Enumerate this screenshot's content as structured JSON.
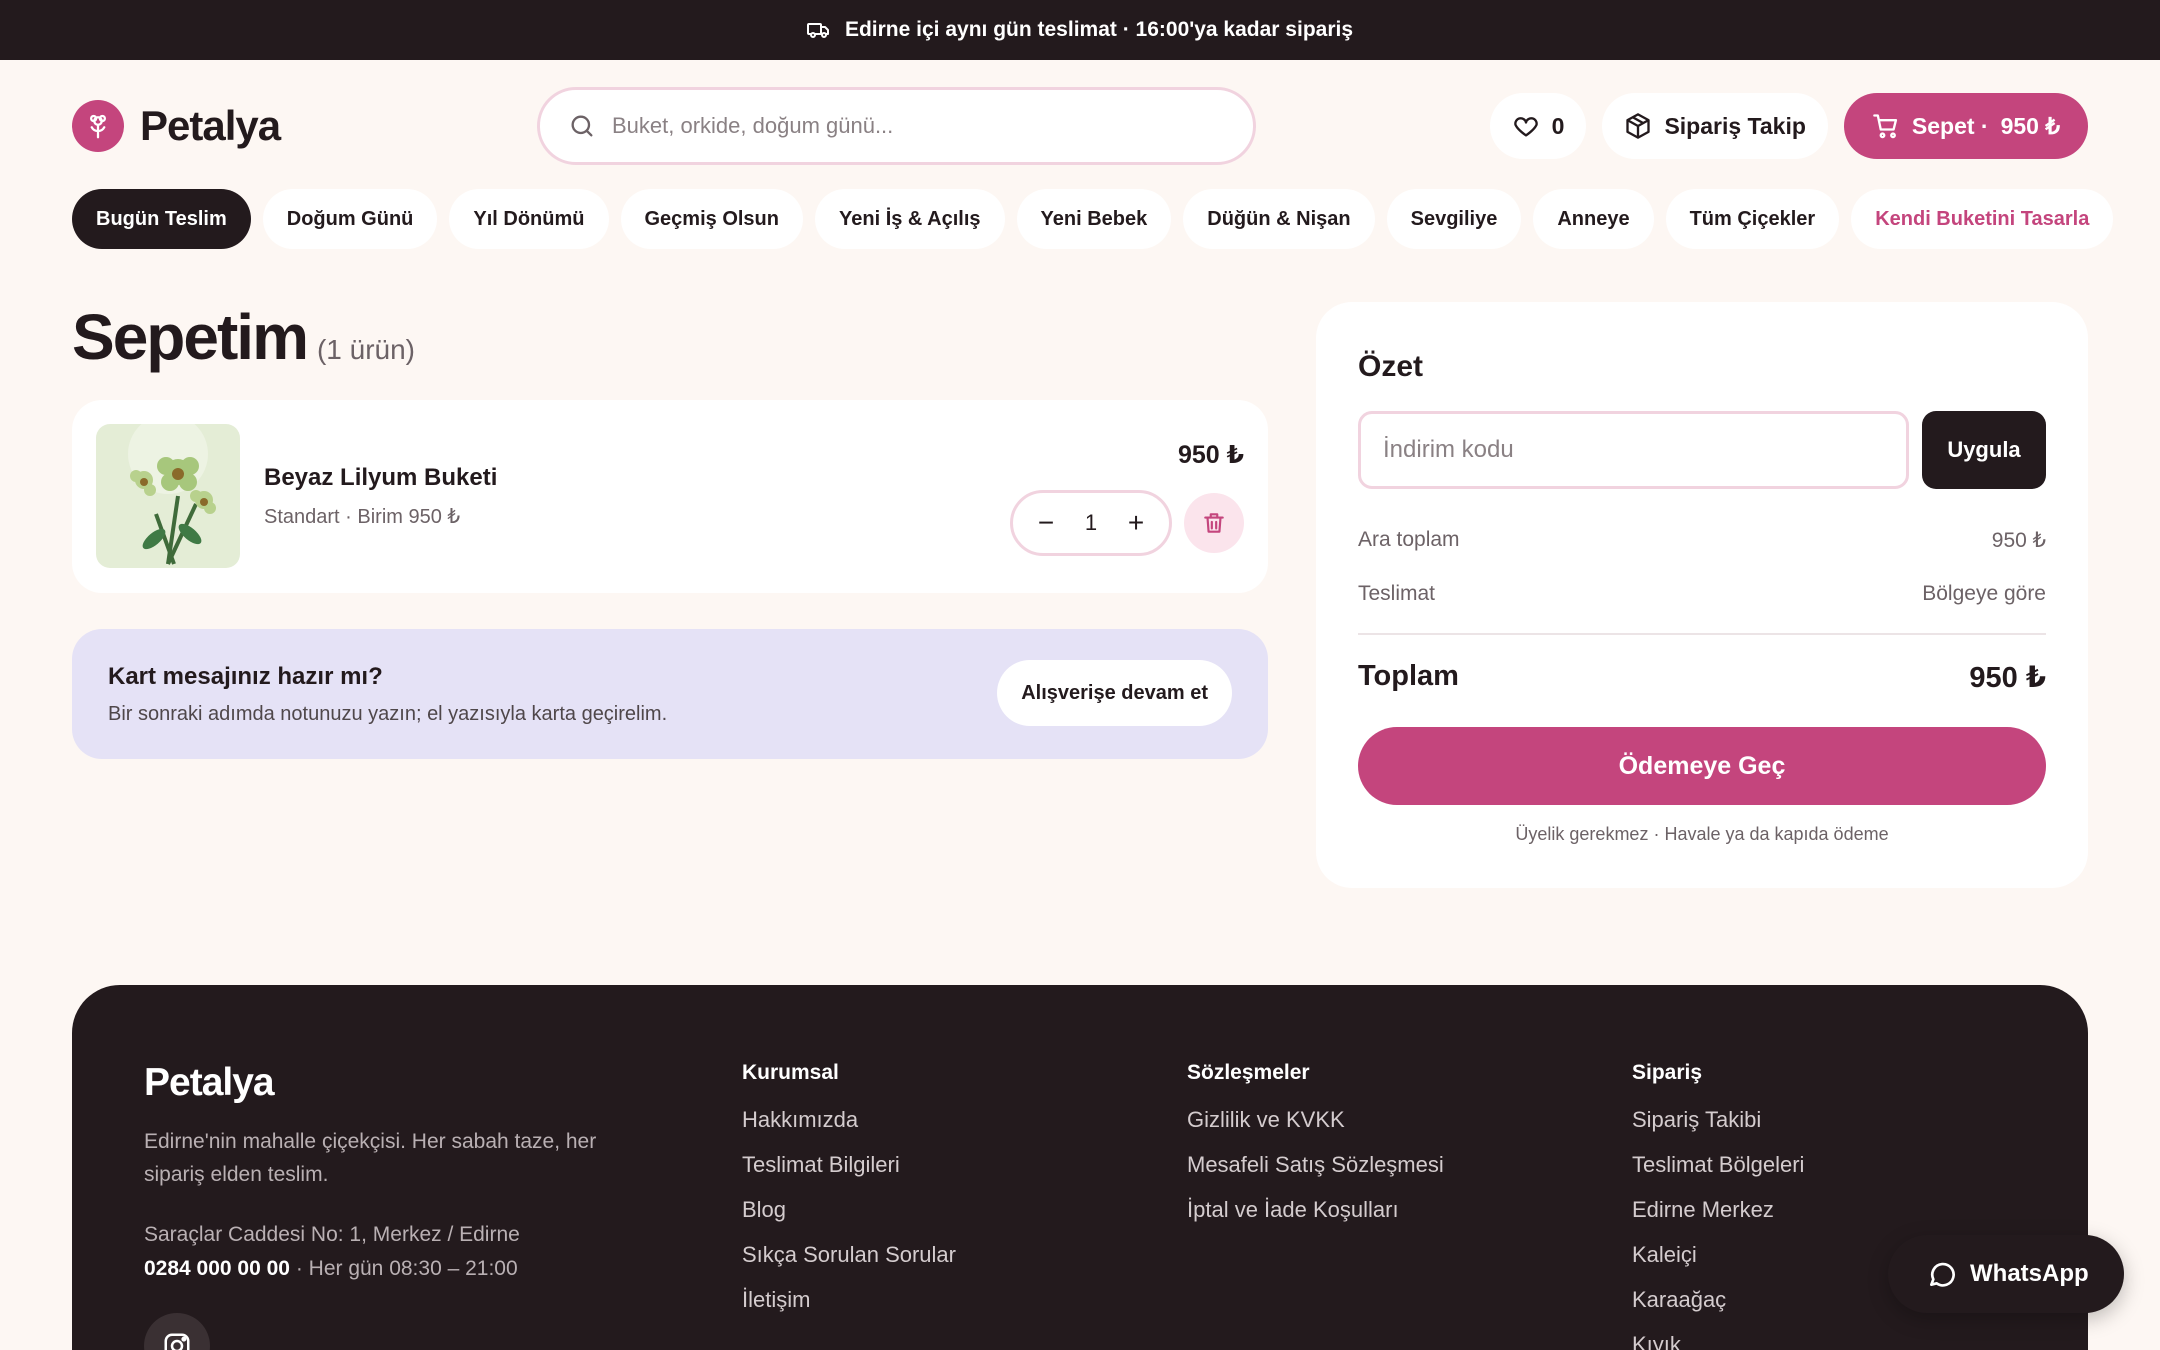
{
  "announcement": {
    "text": "Edirne içi aynı gün teslimat · 16:00'ya kadar sipariş",
    "icon": "truck-icon"
  },
  "header": {
    "logo_text": "Petalya",
    "search_placeholder": "Buket, orkide, doğum günü...",
    "favorites_count": "0",
    "order_tracking_label": "Sipariş Takip",
    "cart_label": "Sepet ·",
    "cart_total": "950 ₺"
  },
  "categories": [
    {
      "label": "Bugün Teslim",
      "active": true
    },
    {
      "label": "Doğum Günü"
    },
    {
      "label": "Yıl Dönümü"
    },
    {
      "label": "Geçmiş Olsun"
    },
    {
      "label": "Yeni İş & Açılış"
    },
    {
      "label": "Yeni Bebek"
    },
    {
      "label": "Düğün & Nişan"
    },
    {
      "label": "Sevgiliye"
    },
    {
      "label": "Anneye"
    },
    {
      "label": "Tüm Çiçekler"
    },
    {
      "label": "Kendi Buketini Tasarla",
      "accent": true
    }
  ],
  "cart": {
    "title": "Sepetim",
    "count_label": "(1 ürün)",
    "items": [
      {
        "name": "Beyaz Lilyum Buketi",
        "subtitle": "Standart · Birim 950 ₺",
        "price": "950 ₺",
        "quantity": "1"
      }
    ]
  },
  "card_message": {
    "title": "Kart mesajınız hazır mı?",
    "text": "Bir sonraki adımda notunuzu yazın; el yazısıyla karta geçirelim.",
    "button": "Alışverişe devam et"
  },
  "summary": {
    "title": "Özet",
    "promo_placeholder": "İndirim kodu",
    "apply_label": "Uygula",
    "subtotal_label": "Ara toplam",
    "subtotal_value": "950 ₺",
    "delivery_label": "Teslimat",
    "delivery_value": "Bölgeye göre",
    "total_label": "Toplam",
    "total_value": "950 ₺",
    "checkout_label": "Ödemeye Geç",
    "note": "Üyelik gerekmez · Havale ya da kapıda ödeme"
  },
  "footer": {
    "brand": "Petalya",
    "description": "Edirne'nin mahalle çiçekçisi. Her sabah taze, her sipariş elden teslim.",
    "address": "Saraçlar Caddesi No: 1, Merkez / Edirne",
    "phone": "0284 000 00 00",
    "hours": "· Her gün 08:30 – 21:00",
    "columns": [
      {
        "title": "Kurumsal",
        "links": [
          "Hakkımızda",
          "Teslimat Bilgileri",
          "Blog",
          "Sıkça Sorulan Sorular",
          "İletişim"
        ]
      },
      {
        "title": "Sözleşmeler",
        "links": [
          "Gizlilik ve KVKK",
          "Mesafeli Satış Sözleşmesi",
          "İptal ve İade Koşulları"
        ]
      },
      {
        "title": "Sipariş",
        "links": [
          "Sipariş Takibi",
          "Teslimat Bölgeleri",
          "Edirne Merkez",
          "Kaleiçi",
          "Karaağaç",
          "Kıyık"
        ]
      }
    ]
  },
  "whatsapp_label": "WhatsApp",
  "colors": {
    "brand": "#c4457d",
    "dark": "#231a1d",
    "background": "#fdf7f3",
    "card_message_bg": "#e5e2f6"
  }
}
